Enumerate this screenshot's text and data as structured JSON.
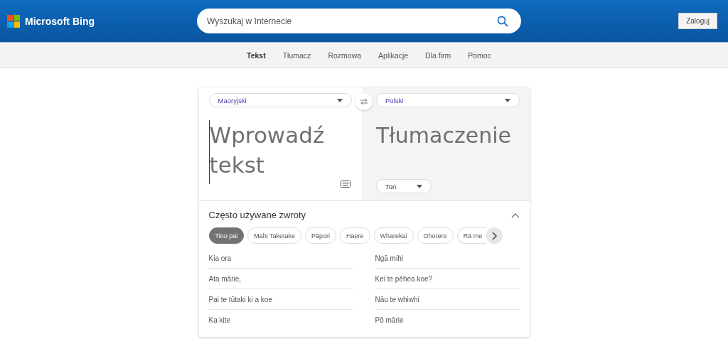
{
  "header": {
    "brand": "Microsoft Bing",
    "search": {
      "placeholder": "Wyszukaj w Internecie"
    },
    "sign_in": "Zaloguj"
  },
  "nav": [
    {
      "label": "Tekst",
      "selected": true
    },
    {
      "label": "Tłumacz",
      "selected": false
    },
    {
      "label": "Rozmowa",
      "selected": false
    },
    {
      "label": "Aplikacje",
      "selected": false
    },
    {
      "label": "Dla firm",
      "selected": false
    },
    {
      "label": "Pomoc",
      "selected": false
    }
  ],
  "translator": {
    "source_language": "Maoryjski",
    "target_language": "Polski",
    "input": {
      "placeholder": "Wprowadź tekst"
    },
    "output_placeholder": "Tłumaczenie",
    "tone": "Ton"
  },
  "phrases": {
    "title": "Często używane zwroty",
    "expanded": true,
    "categories": [
      {
        "label": "Tino pai",
        "selected": true
      },
      {
        "label": "Mahi Taketake",
        "selected": false
      },
      {
        "label": "Pāpori",
        "selected": false
      },
      {
        "label": "Haere",
        "selected": false
      },
      {
        "label": "Wharekai",
        "selected": false
      },
      {
        "label": "Ohorere",
        "selected": false
      },
      {
        "label": "Rā me",
        "selected": false
      }
    ],
    "left": [
      "Kia ora",
      "Ata mārie,",
      "Pai te tūtaki ki a koe",
      "Ka kite"
    ],
    "right": [
      "Ngā mihi",
      "Kei te pēhea koe?",
      "Nāu te whiwhi",
      "Pō mārie"
    ]
  }
}
